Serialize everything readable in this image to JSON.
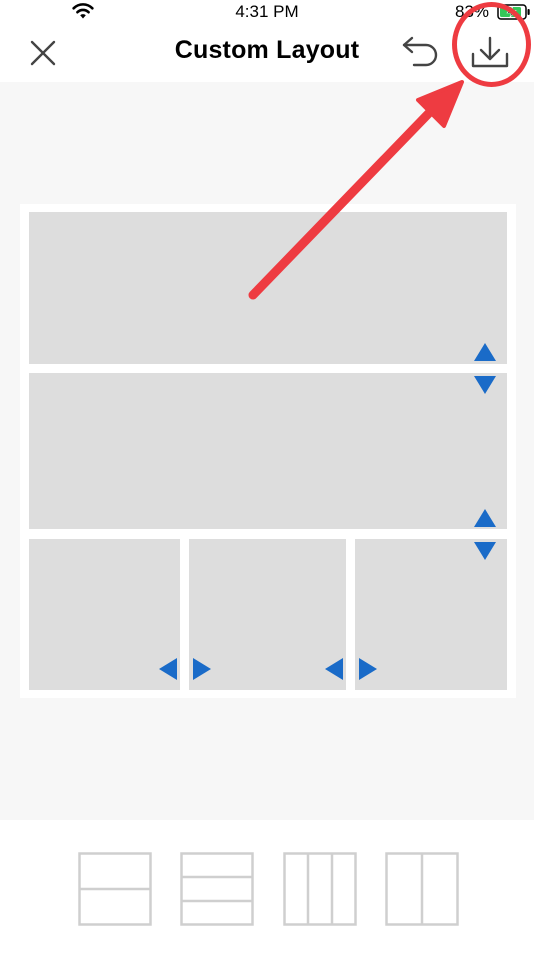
{
  "status_bar": {
    "time": "4:31 PM",
    "battery_percent": "83%",
    "icons": [
      "wifi-icon",
      "battery-charging-icon"
    ]
  },
  "nav_bar": {
    "title": "Custom Layout",
    "icons": [
      "close-icon",
      "undo-icon",
      "download-icon"
    ]
  },
  "layout": {
    "rows": 3,
    "bottom_row_columns": 3,
    "handle_color": "#1a6bc8",
    "cell_color": "#dddddd"
  },
  "annotation": {
    "color": "#ee3b41",
    "target": "download-button"
  },
  "layout_options": [
    "two-rows-layout-icon",
    "three-rows-layout-icon",
    "three-columns-layout-icon",
    "two-columns-layout-icon"
  ]
}
